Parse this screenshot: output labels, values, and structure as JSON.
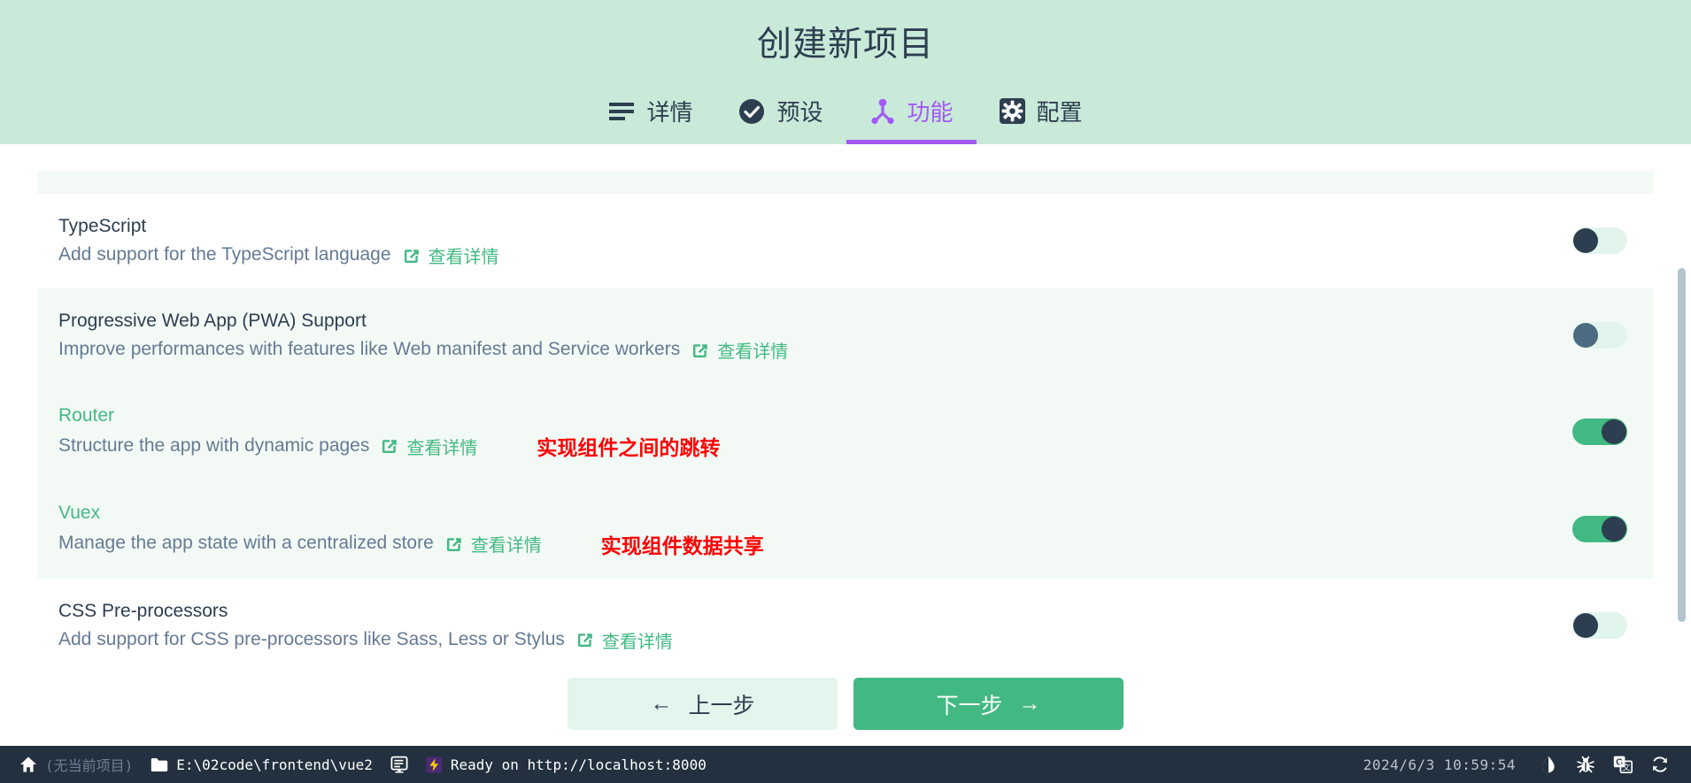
{
  "header": {
    "title": "创建新项目",
    "background": "#c9e9d9",
    "tabs": [
      {
        "label": "详情",
        "icon": "list-lines-icon",
        "active": false
      },
      {
        "label": "预设",
        "icon": "check-circle-icon",
        "active": false
      },
      {
        "label": "功能",
        "icon": "person-node-icon",
        "active": true
      },
      {
        "label": "配置",
        "icon": "gear-square-icon",
        "active": false
      }
    ],
    "active_color": "#a259f4"
  },
  "features": [
    {
      "name": "TypeScript",
      "description": "Add support for the TypeScript language",
      "link_label": "查看详情",
      "enabled": false,
      "shaded": false
    },
    {
      "name": "Progressive Web App (PWA) Support",
      "description": "Improve performances with features like Web manifest and Service workers",
      "link_label": "查看详情",
      "enabled": false,
      "shaded": true
    },
    {
      "name": "Router",
      "description": "Structure the app with dynamic pages",
      "link_label": "查看详情",
      "annotation": "实现组件之间的跳转",
      "enabled": true,
      "shaded": true
    },
    {
      "name": "Vuex",
      "description": "Manage the app state with a centralized store",
      "link_label": "查看详情",
      "annotation": "实现组件数据共享",
      "enabled": true,
      "shaded": true
    },
    {
      "name": "CSS Pre-processors",
      "description": "Add support for CSS pre-processors like Sass, Less or Stylus",
      "link_label": "查看详情",
      "enabled": false,
      "shaded": false
    }
  ],
  "footer": {
    "prev_label": "上一步",
    "next_label": "下一步",
    "prev_arrow": "←",
    "next_arrow": "→"
  },
  "statusbar": {
    "home_icon": "home-icon",
    "project": "(无当前项目)",
    "folder_icon": "folder-icon",
    "path": "E:\\02code\\frontend\\vue2",
    "terminal_icon": "terminal-icon",
    "task_icon": "task-icon",
    "task_status": "Ready on http://localhost:8000",
    "timestamp": "2024/6/3 10:59:54",
    "right_icons": [
      "contrast-droplet-icon",
      "bug-icon",
      "google-translate-icon",
      "sync-icon"
    ]
  },
  "colors": {
    "accent_green": "#42b983",
    "header_bg": "#c9e9d9",
    "annotation_red": "#fc0303",
    "tab_active": "#a259f4",
    "statusbar_bg": "#23303f"
  }
}
